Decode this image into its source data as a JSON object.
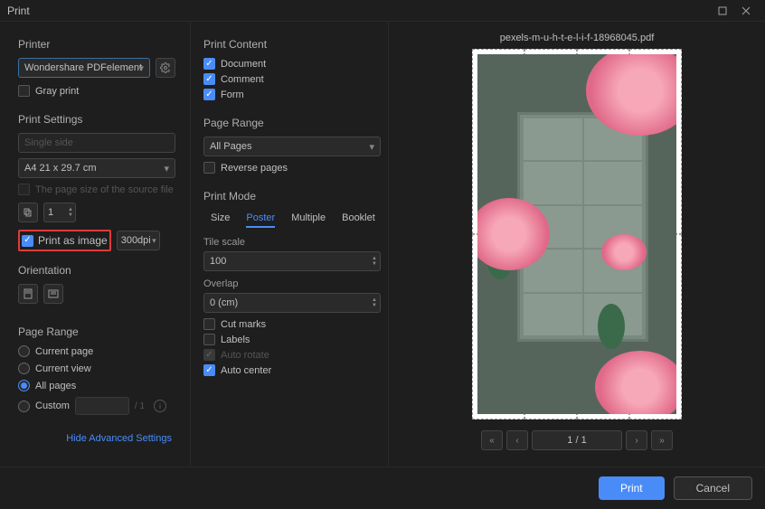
{
  "titlebar": {
    "title": "Print"
  },
  "left": {
    "printer_label": "Printer",
    "printer_value": "Wondershare PDFelement",
    "gray_print": "Gray print",
    "print_settings": "Print Settings",
    "duplex_placeholder": "Single side",
    "paper_size": "A4 21 x 29.7 cm",
    "source_size": "The page size of the source file",
    "copies_value": "1",
    "print_as_image": "Print as image",
    "dpi_value": "300dpi",
    "orientation": "Orientation",
    "page_range": "Page Range",
    "current_page": "Current page",
    "current_view": "Current view",
    "all_pages": "All pages",
    "custom": "Custom",
    "hide_link": "Hide Advanced Settings"
  },
  "mid": {
    "print_content": "Print Content",
    "document": "Document",
    "comment": "Comment",
    "form": "Form",
    "page_range": "Page Range",
    "all_pages": "All Pages",
    "reverse_pages": "Reverse pages",
    "print_mode": "Print Mode",
    "tab_size": "Size",
    "tab_poster": "Poster",
    "tab_multiple": "Multiple",
    "tab_booklet": "Booklet",
    "tile_scale": "Tile scale",
    "tile_scale_value": "100",
    "overlap": "Overlap",
    "overlap_value": "0  (cm)",
    "cut_marks": "Cut marks",
    "labels": "Labels",
    "auto_rotate": "Auto rotate",
    "auto_center": "Auto center"
  },
  "right": {
    "filename": "pexels-m-u-h-t-e-l-i-f-18968045.pdf",
    "page_info": "1 / 1"
  },
  "footer": {
    "print": "Print",
    "cancel": "Cancel"
  }
}
